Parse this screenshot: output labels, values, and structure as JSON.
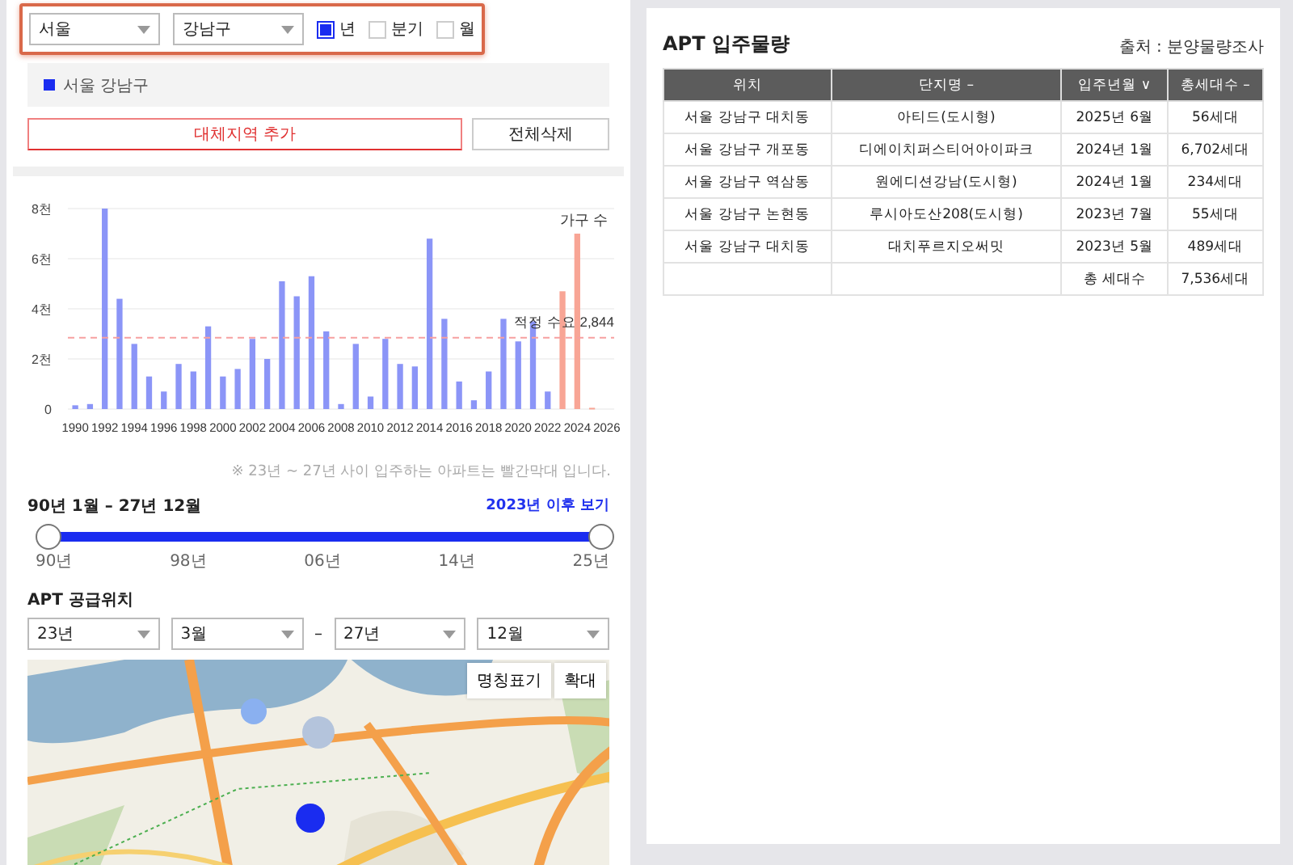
{
  "filters": {
    "region": "서울",
    "district": "강남구",
    "periods": [
      {
        "label": "년",
        "selected": true
      },
      {
        "label": "분기",
        "selected": false
      },
      {
        "label": "월",
        "selected": false
      }
    ]
  },
  "selected_areas": [
    {
      "label": "서울 강남구",
      "color": "#1a2cf0"
    }
  ],
  "buttons": {
    "add": "대체지역 추가",
    "clear": "전체삭제"
  },
  "chart": {
    "chart_data": {
      "type": "bar",
      "stacked": true,
      "categories": [
        "1990",
        null,
        "1992",
        null,
        "1994",
        null,
        "1996",
        null,
        "1998",
        null,
        "2000",
        null,
        "2002",
        null,
        "2004",
        null,
        "2006",
        null,
        "2008",
        null,
        "2010",
        null,
        "2012",
        null,
        "2014",
        null,
        "2016",
        null,
        "2018",
        null,
        "2020",
        null,
        "2022",
        null,
        "2024",
        null,
        "2026"
      ],
      "ylabel": "가구 수",
      "grid": true,
      "series": [
        {
          "color": "#8b95f7",
          "values": [
            0.15,
            0.2,
            8,
            4.4,
            2.6,
            1.3,
            0.7,
            1.8,
            1.5,
            3.3,
            1.3,
            1.6,
            2.8,
            2,
            5.1,
            4.5,
            5.3,
            3.1,
            0.2,
            2.6,
            0.5,
            2.8,
            1.8,
            1.7,
            6.8,
            3.6,
            1.1,
            0.35,
            1.5,
            3.6,
            2.7,
            3.5,
            0.7,
            null,
            null,
            null,
            null
          ]
        },
        {
          "color": "#f8a595",
          "values": [
            null,
            null,
            null,
            null,
            null,
            null,
            null,
            null,
            null,
            null,
            null,
            null,
            null,
            null,
            null,
            null,
            null,
            null,
            null,
            null,
            null,
            null,
            null,
            null,
            null,
            null,
            null,
            null,
            null,
            null,
            null,
            null,
            null,
            4.7,
            7,
            0.05,
            null
          ]
        }
      ],
      "ylim": [
        0,
        8
      ],
      "yticks": [
        {
          "value": 0,
          "label": "0"
        },
        {
          "value": 2,
          "label": "2천"
        },
        {
          "value": 4,
          "label": "4천"
        },
        {
          "value": 6,
          "label": "6천"
        },
        {
          "value": 8,
          "label": "8천"
        }
      ],
      "ref_lines": [
        {
          "axis": "y",
          "value": 2.844,
          "label": "적정 수요 2,844"
        }
      ]
    },
    "note": "※ 23년 ~ 27년 사이 입주하는 아파트는 빨간막대 입니다."
  },
  "range": {
    "label": "90년 1월 – 27년 12월",
    "link": "2023년 이후 보기",
    "thumbs": [
      {
        "level": 0
      },
      {
        "level": 1
      }
    ],
    "ticks": [
      "90년",
      "98년",
      "06년",
      "14년",
      "25년"
    ]
  },
  "supply": {
    "title": "APT 공급위치",
    "selects": [
      "23년",
      "3월",
      "27년",
      "12월"
    ],
    "separator": "–",
    "map_buttons": [
      "명칭표기",
      "확대"
    ]
  },
  "occupancy": {
    "title": "APT 입주물량",
    "source": "출처 : 분양물량조사",
    "columns": [
      "위치",
      "단지명 –",
      "입주년월 ∨",
      "총세대수 –"
    ],
    "rows": [
      [
        "서울 강남구 대치동",
        "아티드(도시형)",
        "2025년 6월",
        "56세대"
      ],
      [
        "서울 강남구 개포동",
        "디에이치퍼스티어아이파크",
        "2024년 1월",
        "6,702세대"
      ],
      [
        "서울 강남구 역삼동",
        "원에디션강남(도시형)",
        "2024년 1월",
        "234세대"
      ],
      [
        "서울 강남구 논현동",
        "루시아도산208(도시형)",
        "2023년 7월",
        "55세대"
      ],
      [
        "서울 강남구 대치동",
        "대치푸르지오써밋",
        "2023년 5월",
        "489세대"
      ]
    ],
    "total": {
      "label": "총 세대수",
      "value": "7,536세대"
    }
  }
}
